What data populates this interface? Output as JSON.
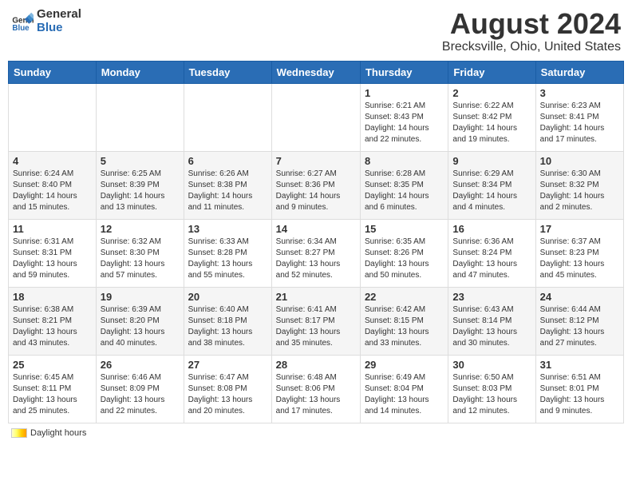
{
  "header": {
    "logo_general": "General",
    "logo_blue": "Blue",
    "title": "August 2024",
    "subtitle": "Brecksville, Ohio, United States"
  },
  "weekdays": [
    "Sunday",
    "Monday",
    "Tuesday",
    "Wednesday",
    "Thursday",
    "Friday",
    "Saturday"
  ],
  "weeks": [
    [
      {
        "day": "",
        "info": ""
      },
      {
        "day": "",
        "info": ""
      },
      {
        "day": "",
        "info": ""
      },
      {
        "day": "",
        "info": ""
      },
      {
        "day": "1",
        "info": "Sunrise: 6:21 AM\nSunset: 8:43 PM\nDaylight: 14 hours\nand 22 minutes."
      },
      {
        "day": "2",
        "info": "Sunrise: 6:22 AM\nSunset: 8:42 PM\nDaylight: 14 hours\nand 19 minutes."
      },
      {
        "day": "3",
        "info": "Sunrise: 6:23 AM\nSunset: 8:41 PM\nDaylight: 14 hours\nand 17 minutes."
      }
    ],
    [
      {
        "day": "4",
        "info": "Sunrise: 6:24 AM\nSunset: 8:40 PM\nDaylight: 14 hours\nand 15 minutes."
      },
      {
        "day": "5",
        "info": "Sunrise: 6:25 AM\nSunset: 8:39 PM\nDaylight: 14 hours\nand 13 minutes."
      },
      {
        "day": "6",
        "info": "Sunrise: 6:26 AM\nSunset: 8:38 PM\nDaylight: 14 hours\nand 11 minutes."
      },
      {
        "day": "7",
        "info": "Sunrise: 6:27 AM\nSunset: 8:36 PM\nDaylight: 14 hours\nand 9 minutes."
      },
      {
        "day": "8",
        "info": "Sunrise: 6:28 AM\nSunset: 8:35 PM\nDaylight: 14 hours\nand 6 minutes."
      },
      {
        "day": "9",
        "info": "Sunrise: 6:29 AM\nSunset: 8:34 PM\nDaylight: 14 hours\nand 4 minutes."
      },
      {
        "day": "10",
        "info": "Sunrise: 6:30 AM\nSunset: 8:32 PM\nDaylight: 14 hours\nand 2 minutes."
      }
    ],
    [
      {
        "day": "11",
        "info": "Sunrise: 6:31 AM\nSunset: 8:31 PM\nDaylight: 13 hours\nand 59 minutes."
      },
      {
        "day": "12",
        "info": "Sunrise: 6:32 AM\nSunset: 8:30 PM\nDaylight: 13 hours\nand 57 minutes."
      },
      {
        "day": "13",
        "info": "Sunrise: 6:33 AM\nSunset: 8:28 PM\nDaylight: 13 hours\nand 55 minutes."
      },
      {
        "day": "14",
        "info": "Sunrise: 6:34 AM\nSunset: 8:27 PM\nDaylight: 13 hours\nand 52 minutes."
      },
      {
        "day": "15",
        "info": "Sunrise: 6:35 AM\nSunset: 8:26 PM\nDaylight: 13 hours\nand 50 minutes."
      },
      {
        "day": "16",
        "info": "Sunrise: 6:36 AM\nSunset: 8:24 PM\nDaylight: 13 hours\nand 47 minutes."
      },
      {
        "day": "17",
        "info": "Sunrise: 6:37 AM\nSunset: 8:23 PM\nDaylight: 13 hours\nand 45 minutes."
      }
    ],
    [
      {
        "day": "18",
        "info": "Sunrise: 6:38 AM\nSunset: 8:21 PM\nDaylight: 13 hours\nand 43 minutes."
      },
      {
        "day": "19",
        "info": "Sunrise: 6:39 AM\nSunset: 8:20 PM\nDaylight: 13 hours\nand 40 minutes."
      },
      {
        "day": "20",
        "info": "Sunrise: 6:40 AM\nSunset: 8:18 PM\nDaylight: 13 hours\nand 38 minutes."
      },
      {
        "day": "21",
        "info": "Sunrise: 6:41 AM\nSunset: 8:17 PM\nDaylight: 13 hours\nand 35 minutes."
      },
      {
        "day": "22",
        "info": "Sunrise: 6:42 AM\nSunset: 8:15 PM\nDaylight: 13 hours\nand 33 minutes."
      },
      {
        "day": "23",
        "info": "Sunrise: 6:43 AM\nSunset: 8:14 PM\nDaylight: 13 hours\nand 30 minutes."
      },
      {
        "day": "24",
        "info": "Sunrise: 6:44 AM\nSunset: 8:12 PM\nDaylight: 13 hours\nand 27 minutes."
      }
    ],
    [
      {
        "day": "25",
        "info": "Sunrise: 6:45 AM\nSunset: 8:11 PM\nDaylight: 13 hours\nand 25 minutes."
      },
      {
        "day": "26",
        "info": "Sunrise: 6:46 AM\nSunset: 8:09 PM\nDaylight: 13 hours\nand 22 minutes."
      },
      {
        "day": "27",
        "info": "Sunrise: 6:47 AM\nSunset: 8:08 PM\nDaylight: 13 hours\nand 20 minutes."
      },
      {
        "day": "28",
        "info": "Sunrise: 6:48 AM\nSunset: 8:06 PM\nDaylight: 13 hours\nand 17 minutes."
      },
      {
        "day": "29",
        "info": "Sunrise: 6:49 AM\nSunset: 8:04 PM\nDaylight: 13 hours\nand 14 minutes."
      },
      {
        "day": "30",
        "info": "Sunrise: 6:50 AM\nSunset: 8:03 PM\nDaylight: 13 hours\nand 12 minutes."
      },
      {
        "day": "31",
        "info": "Sunrise: 6:51 AM\nSunset: 8:01 PM\nDaylight: 13 hours\nand 9 minutes."
      }
    ]
  ],
  "footer": {
    "legend_label": "Daylight hours"
  }
}
